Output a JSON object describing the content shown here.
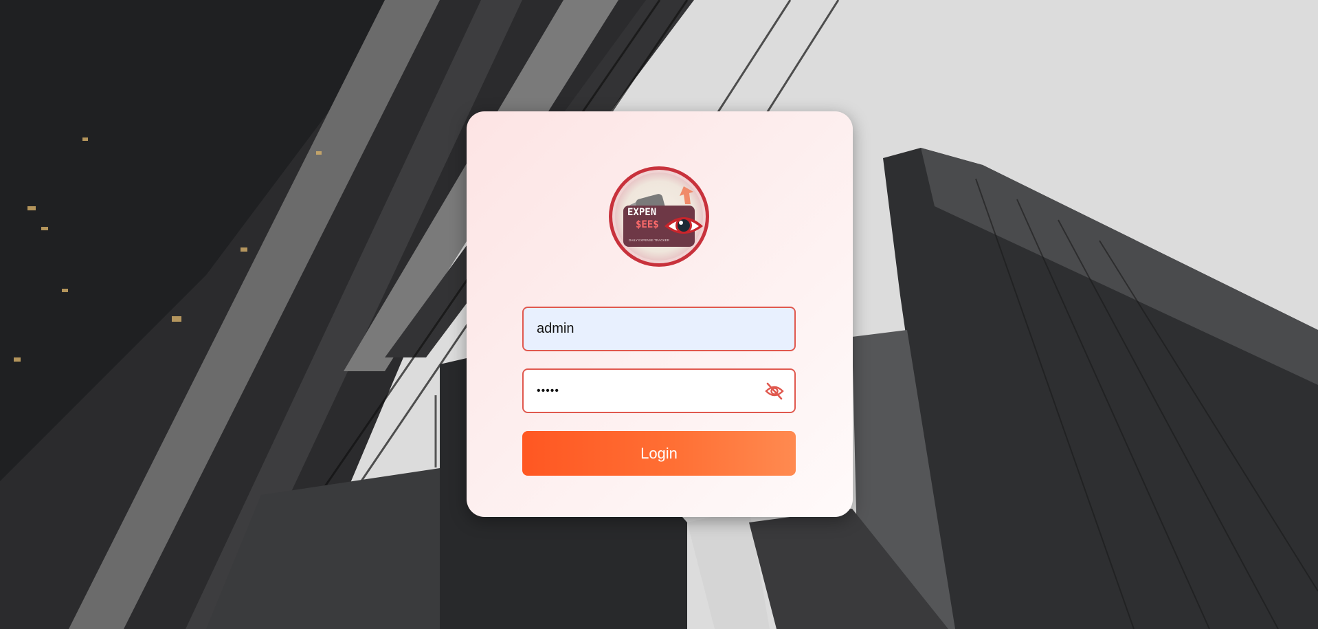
{
  "login": {
    "username_value": "admin",
    "password_value": "admin",
    "submit_label": "Login"
  },
  "logo": {
    "line1": "EXPEN",
    "line2": "$EE$",
    "tagline": "DAILY EXPENSE TRACKER"
  },
  "icons": {
    "password_toggle": "eye-slash-icon"
  },
  "colors": {
    "accent": "#ff5722",
    "field_border": "#e0584e",
    "logo_ring": "#c8323c",
    "card_background": "#fdeeee"
  }
}
